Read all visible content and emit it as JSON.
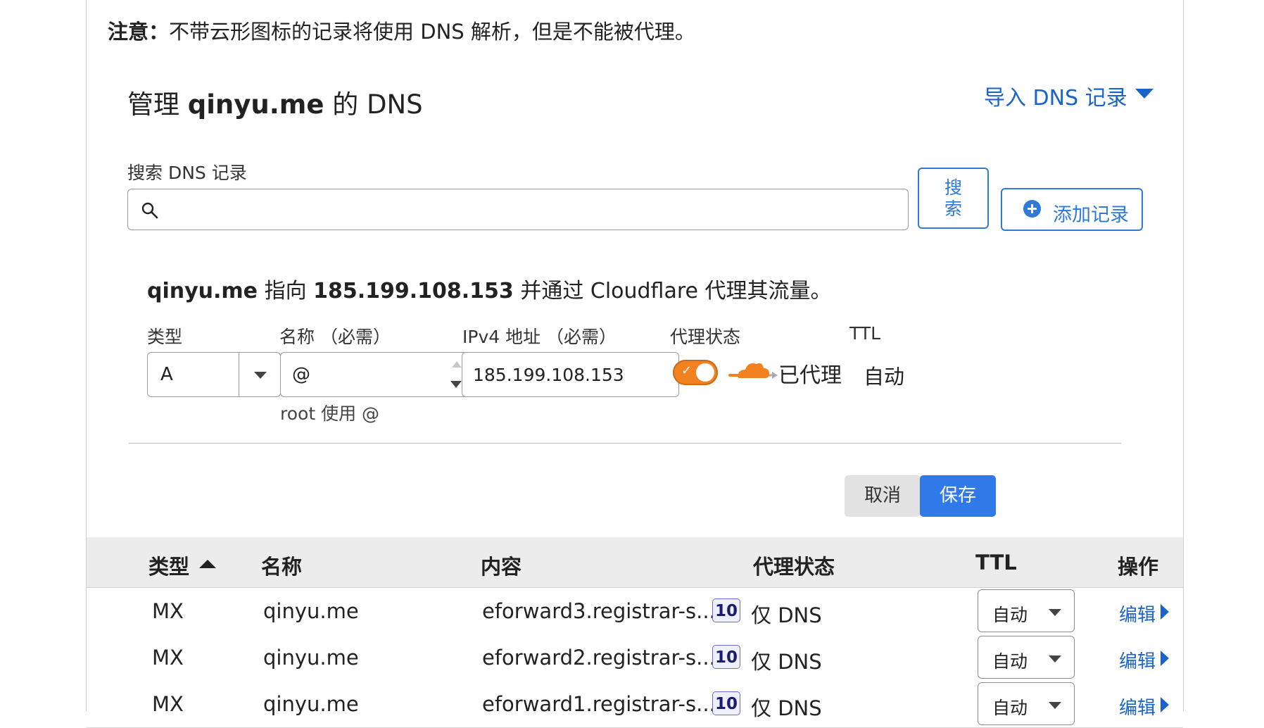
{
  "note": {
    "bold": "注意：",
    "text": "不带云形图标的记录将使用 DNS 解析，但是不能被代理。"
  },
  "header": {
    "prefix": "管理 ",
    "domain": "qinyu.me",
    "suffix": " 的 DNS",
    "import_label": "导入 DNS 记录"
  },
  "search": {
    "label": "搜索 DNS 记录",
    "placeholder": "",
    "button_line1": "搜",
    "button_line2": "索",
    "add_label": "添加记录"
  },
  "editor": {
    "desc_domain": "qinyu.me",
    "desc_mid": " 指向 ",
    "desc_ip": "185.199.108.153",
    "desc_tail": " 并通过 Cloudflare 代理其流量。",
    "type_label": "类型",
    "type_value": "A",
    "name_label": "名称 （必需）",
    "name_value": "@",
    "name_hint": "root 使用 @",
    "ip_label": "IPv4 地址 （必需）",
    "ip_value": "185.199.108.153",
    "proxy_label": "代理状态",
    "proxy_value": "已代理",
    "ttl_label": "TTL",
    "ttl_value": "自动",
    "cancel_label": "取消",
    "save_label": "保存",
    "toggle_on": true,
    "accent_color": "#f48120"
  },
  "table": {
    "headers": {
      "type": "类型",
      "name": "名称",
      "content": "内容",
      "proxy": "代理状态",
      "ttl": "TTL",
      "action": "操作"
    },
    "rows": [
      {
        "type": "MX",
        "name": "qinyu.me",
        "content": "eforward3.registrar-s...",
        "priority": "10",
        "proxy": "仅 DNS",
        "ttl": "自动",
        "action": "编辑"
      },
      {
        "type": "MX",
        "name": "qinyu.me",
        "content": "eforward2.registrar-s...",
        "priority": "10",
        "proxy": "仅 DNS",
        "ttl": "自动",
        "action": "编辑"
      },
      {
        "type": "MX",
        "name": "qinyu.me",
        "content": "eforward1.registrar-s...",
        "priority": "10",
        "proxy": "仅 DNS",
        "ttl": "自动",
        "action": "编辑"
      }
    ]
  },
  "colors": {
    "link": "#1a63c7",
    "primary": "#2f79e8",
    "proxy_orange": "#f48120"
  },
  "icons": {
    "search": "search-icon",
    "add": "plus-circle-icon",
    "cloud": "cloud-icon",
    "sort": "sort-up-icon"
  }
}
